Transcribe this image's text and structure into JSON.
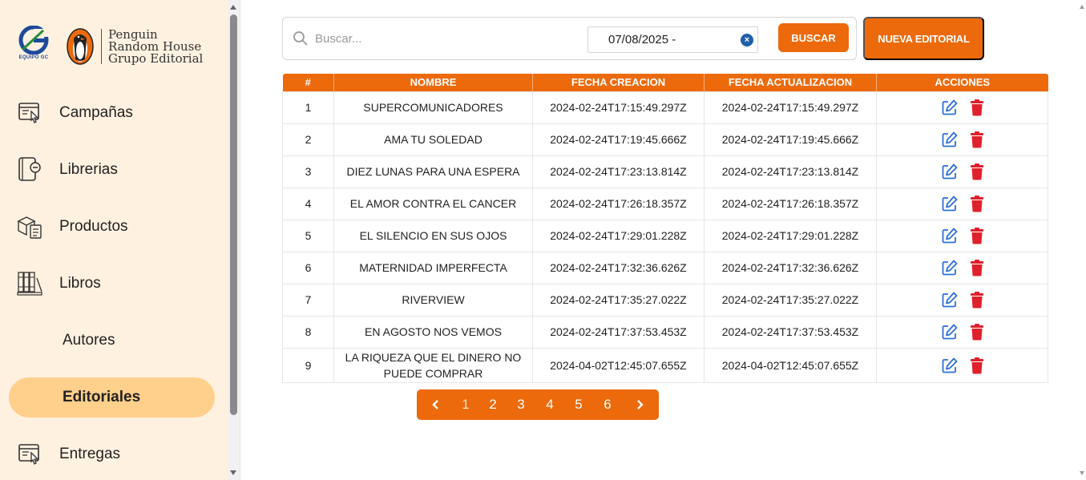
{
  "brand": {
    "gc_letter": "G",
    "gc_tag": "EQUIPO GC",
    "prh_lines": [
      "Penguin",
      "Random House",
      "Grupo Editorial"
    ]
  },
  "sidebar": {
    "items": [
      {
        "label": "Campañas",
        "icon": "campaign-icon",
        "active": false
      },
      {
        "label": "Librerias",
        "icon": "bookstore-icon",
        "active": false
      },
      {
        "label": "Productos",
        "icon": "products-icon",
        "active": false
      },
      {
        "label": "Libros",
        "icon": "books-icon",
        "active": false
      },
      {
        "label": "Autores",
        "icon": "",
        "active": false
      },
      {
        "label": "Editoriales",
        "icon": "",
        "active": true
      },
      {
        "label": "Entregas",
        "icon": "delivery-icon",
        "active": false
      }
    ]
  },
  "search": {
    "placeholder": "Buscar...",
    "date_value": "07/08/2025 -",
    "date_clear": "×",
    "button_label": "BUSCAR"
  },
  "new_button_label": "NUEVA EDITORIAL",
  "table": {
    "headers": [
      "#",
      "NOMBRE",
      "FECHA CREACION",
      "FECHA ACTUALIZACION",
      "ACCIONES"
    ],
    "rows": [
      {
        "id": "1",
        "nombre": "SUPERCOMUNICADORES",
        "creacion": "2024-02-24T17:15:49.297Z",
        "actualizacion": "2024-02-24T17:15:49.297Z"
      },
      {
        "id": "2",
        "nombre": "AMA TU SOLEDAD",
        "creacion": "2024-02-24T17:19:45.666Z",
        "actualizacion": "2024-02-24T17:19:45.666Z"
      },
      {
        "id": "3",
        "nombre": "DIEZ LUNAS PARA UNA ESPERA",
        "creacion": "2024-02-24T17:23:13.814Z",
        "actualizacion": "2024-02-24T17:23:13.814Z"
      },
      {
        "id": "4",
        "nombre": "EL AMOR CONTRA EL CANCER",
        "creacion": "2024-02-24T17:26:18.357Z",
        "actualizacion": "2024-02-24T17:26:18.357Z"
      },
      {
        "id": "5",
        "nombre": "EL SILENCIO EN SUS OJOS",
        "creacion": "2024-02-24T17:29:01.228Z",
        "actualizacion": "2024-02-24T17:29:01.228Z"
      },
      {
        "id": "6",
        "nombre": "MATERNIDAD IMPERFECTA",
        "creacion": "2024-02-24T17:32:36.626Z",
        "actualizacion": "2024-02-24T17:32:36.626Z"
      },
      {
        "id": "7",
        "nombre": "RIVERVIEW",
        "creacion": "2024-02-24T17:35:27.022Z",
        "actualizacion": "2024-02-24T17:35:27.022Z"
      },
      {
        "id": "8",
        "nombre": "EN AGOSTO NOS VEMOS",
        "creacion": "2024-02-24T17:37:53.453Z",
        "actualizacion": "2024-02-24T17:37:53.453Z"
      },
      {
        "id": "9",
        "nombre": "LA RIQUEZA QUE EL DINERO NO PUEDE COMPRAR",
        "creacion": "2024-04-02T12:45:07.655Z",
        "actualizacion": "2024-04-02T12:45:07.655Z"
      }
    ]
  },
  "pagination": {
    "prev": "‹",
    "next": "›",
    "pages": [
      "1",
      "2",
      "3",
      "4",
      "5",
      "6"
    ],
    "current": "1"
  },
  "colors": {
    "accent": "#ec6a0c",
    "sidebar_bg": "#fff1e0",
    "active_item": "#ffcf8c",
    "edit_icon": "#2d6fd6",
    "delete_icon": "#e0202a"
  }
}
